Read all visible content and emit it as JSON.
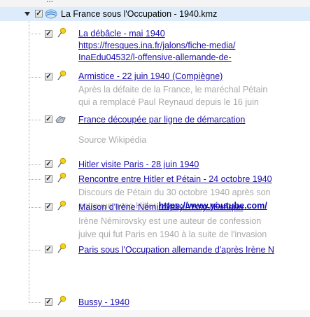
{
  "header": {
    "partial_label": "..."
  },
  "root": {
    "title": "La France sous l'Occupation - 1940.kmz",
    "checked": true,
    "expanded": true
  },
  "items": [
    {
      "title": "La débâcle - mai 1940",
      "desc_links": [
        "https://fresques.ina.fr/jalons/fiche-media/",
        "InaEdu04532/l-offensive-allemande-de-"
      ],
      "icon": "yellow-pushpin-icon"
    },
    {
      "title": "Armistice - 22 juin 1940 (Compiègne)",
      "desc_lines": [
        "Après la défaite de la France, le maréchal Pétain",
        "qui a remplacé Paul Reynaud depuis le 16 juin"
      ],
      "icon": "yellow-pushpin-icon"
    },
    {
      "title": "France découpée par ligne de démarcation",
      "desc_lines": [
        "Source Wikipédia"
      ],
      "icon": "polygon-icon"
    },
    {
      "title": "Hitler visite Paris - 28 juin 1940",
      "icon": "yellow-pushpin-icon"
    },
    {
      "title": "Rencontre entre Hitler et Pétain - 24 octobre 1940",
      "desc_lines": [
        "Discours de Pétain du 30 octobre 1940 après son"
      ],
      "desc_line2_text": "entrevue avec Hitler ",
      "desc_line2_link": "https://www.youtube.com/",
      "icon": "yellow-pushpin-icon"
    },
    {
      "title": "Maison d'Irène Némirovsky - Issy-l'Évêque",
      "desc_lines": [
        "Irène Némirovsky est une auteur de confession",
        "juive qui fut Paris en 1940 à la suite de l'invasion"
      ],
      "icon": "yellow-pushpin-icon"
    },
    {
      "title": "Paris sous l'Occupation allemande d'après Irène N",
      "icon": "yellow-pushpin-icon"
    },
    {
      "title": "Bussy - 1940",
      "icon": "yellow-pushpin-icon"
    }
  ],
  "colors": {
    "link": "#1a0dab",
    "description": "#a9a9a9",
    "selection": "#dcecfa"
  }
}
